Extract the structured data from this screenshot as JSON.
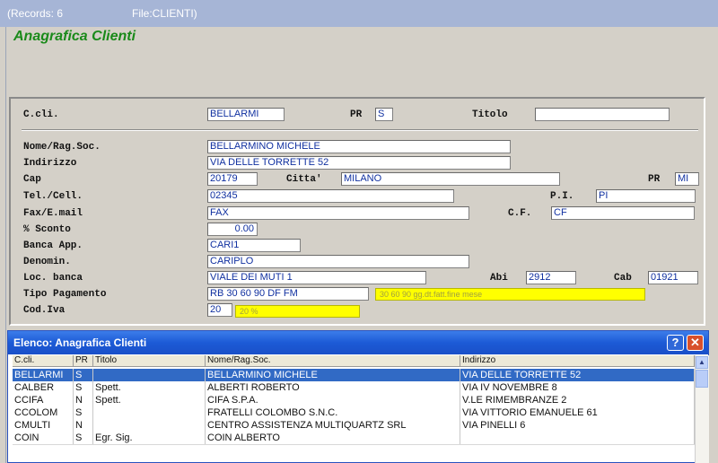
{
  "window": {
    "records": "(Records: 6",
    "file": "File:CLIENTI)"
  },
  "form": {
    "title": "Anagrafica Clienti",
    "labels": {
      "ccli": "C.cli.",
      "pr": "PR",
      "titolo": "Titolo",
      "nome": "Nome/Rag.Soc.",
      "indirizzo": "Indirizzo",
      "cap": "Cap",
      "citta": "Citta'",
      "pr2": "PR",
      "tel": "Tel./Cell.",
      "pi": "P.I.",
      "fax": "Fax/E.mail",
      "cf": "C.F.",
      "sconto": "% Sconto",
      "banca": "Banca App.",
      "denomin": "Denomin.",
      "locbanca": "Loc. banca",
      "abi": "Abi",
      "cab": "Cab",
      "tipopag": "Tipo Pagamento",
      "codiva": "Cod.Iva"
    },
    "values": {
      "ccli": "BELLARMI",
      "pr": "S",
      "titolo": "",
      "nome": "BELLARMINO MICHELE",
      "indirizzo": "VIA DELLE TORRETTE 52",
      "cap": "20179",
      "citta": "MILANO",
      "pr2": "MI",
      "tel": "02345",
      "pi": "PI",
      "fax": "FAX",
      "cf": "CF",
      "sconto": "0.00",
      "banca": "CARI1",
      "denomin": "CARIPLO",
      "locbanca": "VIALE DEI MUTI 1",
      "abi": "2912",
      "cab": "01921",
      "tipopag": "RB 30 60 90 DF FM",
      "tipopag_desc": "30 60 90 gg.dt.fatt.fine mese",
      "codiva": "20",
      "codiva_desc": "20 %"
    }
  },
  "list": {
    "title": "Elenco: Anagrafica Clienti",
    "help_label": "?",
    "close_label": "✕",
    "columns": [
      "C.cli.",
      "PR",
      "Titolo",
      "Nome/Rag.Soc.",
      "Indirizzo"
    ],
    "rows": [
      [
        "BELLARMI",
        "S",
        "",
        "BELLARMINO MICHELE",
        "VIA DELLE TORRETTE 52"
      ],
      [
        "CALBER",
        "S",
        "Spett.",
        "ALBERTI ROBERTO",
        "VIA IV NOVEMBRE 8"
      ],
      [
        "CCIFA",
        "N",
        "Spett.",
        "CIFA S.P.A.",
        "V.LE RIMEMBRANZE 2"
      ],
      [
        "CCOLOM",
        "S",
        "",
        "FRATELLI COLOMBO S.N.C.",
        "VIA VITTORIO EMANUELE 61"
      ],
      [
        "CMULTI",
        "N",
        "",
        "CENTRO ASSISTENZA MULTIQUARTZ SRL",
        "VIA PINELLI 6"
      ],
      [
        "COIN",
        "S",
        "Egr. Sig.",
        "COIN ALBERTO",
        ""
      ]
    ],
    "selected_row": 0,
    "scroll_up_icon": "▲"
  },
  "colors": {
    "title_green": "#1a8a1a",
    "field_text": "#1030a0",
    "highlight": "#ffff00",
    "selection": "#316ac5",
    "list_titlebar": "#1c5ad6"
  }
}
